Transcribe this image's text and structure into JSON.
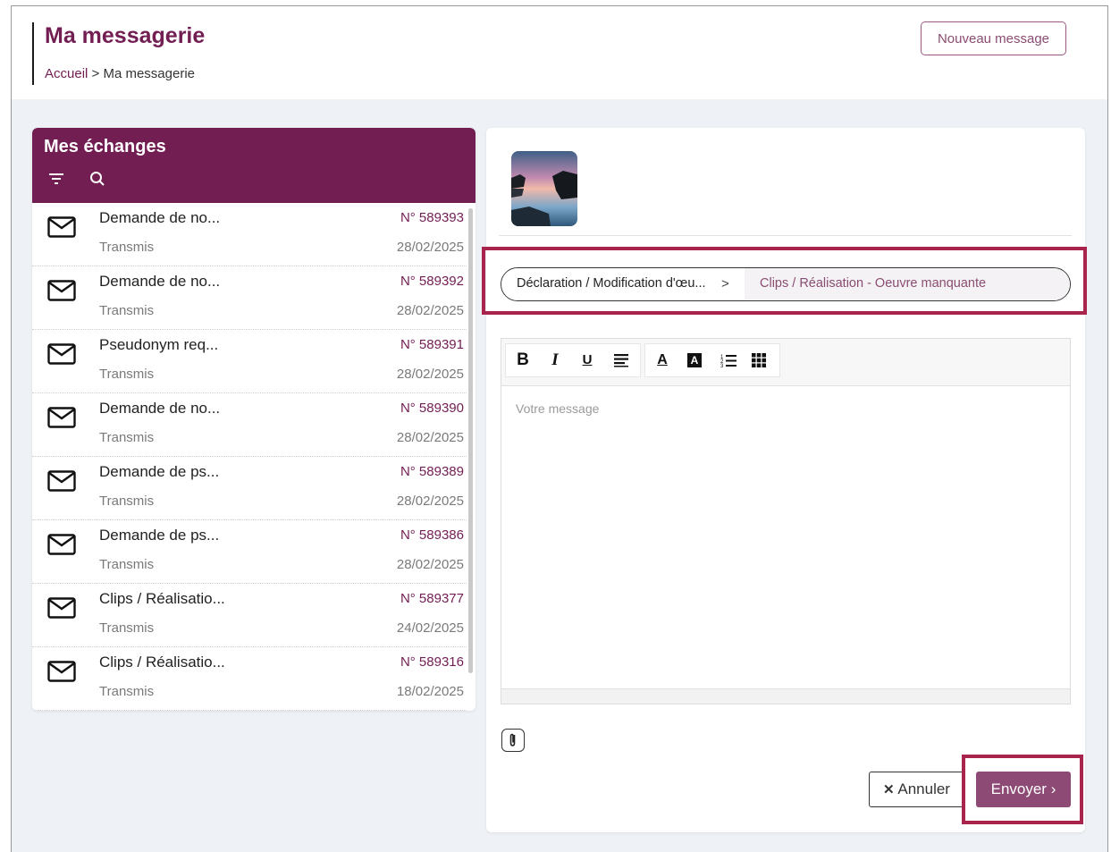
{
  "header": {
    "title": "Ma messagerie",
    "breadcrumb": {
      "home": "Accueil",
      "separator": ">",
      "current": "Ma messagerie"
    },
    "new_message_label": "Nouveau message"
  },
  "sidebar": {
    "title": "Mes échanges",
    "filter_icon": "filter-icon",
    "search_icon": "search-icon",
    "items": [
      {
        "subject": "Demande de no...",
        "number": "N° 589393",
        "status": "Transmis",
        "date": "28/02/2025"
      },
      {
        "subject": "Demande de no...",
        "number": "N° 589392",
        "status": "Transmis",
        "date": "28/02/2025"
      },
      {
        "subject": "Pseudonym req...",
        "number": "N° 589391",
        "status": "Transmis",
        "date": "28/02/2025"
      },
      {
        "subject": "Demande de no...",
        "number": "N° 589390",
        "status": "Transmis",
        "date": "28/02/2025"
      },
      {
        "subject": "Demande de ps...",
        "number": "N° 589389",
        "status": "Transmis",
        "date": "28/02/2025"
      },
      {
        "subject": "Demande de ps...",
        "number": "N° 589386",
        "status": "Transmis",
        "date": "28/02/2025"
      },
      {
        "subject": "Clips / Réalisatio...",
        "number": "N° 589377",
        "status": "Transmis",
        "date": "24/02/2025"
      },
      {
        "subject": "Clips / Réalisatio...",
        "number": "N° 589316",
        "status": "Transmis",
        "date": "18/02/2025"
      }
    ]
  },
  "compose": {
    "category_path": {
      "first": "Déclaration / Modification d'œu...",
      "separator": ">",
      "second": "Clips / Réalisation - Oeuvre manquante"
    },
    "toolbar": {
      "bold": "B",
      "italic": "I",
      "underline": "U",
      "align_icon": "align-left-icon",
      "font_color_label": "A",
      "bg_color_label": "A",
      "ordered_list_icon": "ordered-list-icon",
      "table_icon": "table-icon"
    },
    "placeholder": "Votre message",
    "attach_icon": "paperclip-icon",
    "cancel_label": "Annuler",
    "send_label": "Envoyer"
  },
  "colors": {
    "brand": "#731e53",
    "send_button": "#8c4a74",
    "highlight": "#a8244d",
    "background": "#eef1f5"
  }
}
